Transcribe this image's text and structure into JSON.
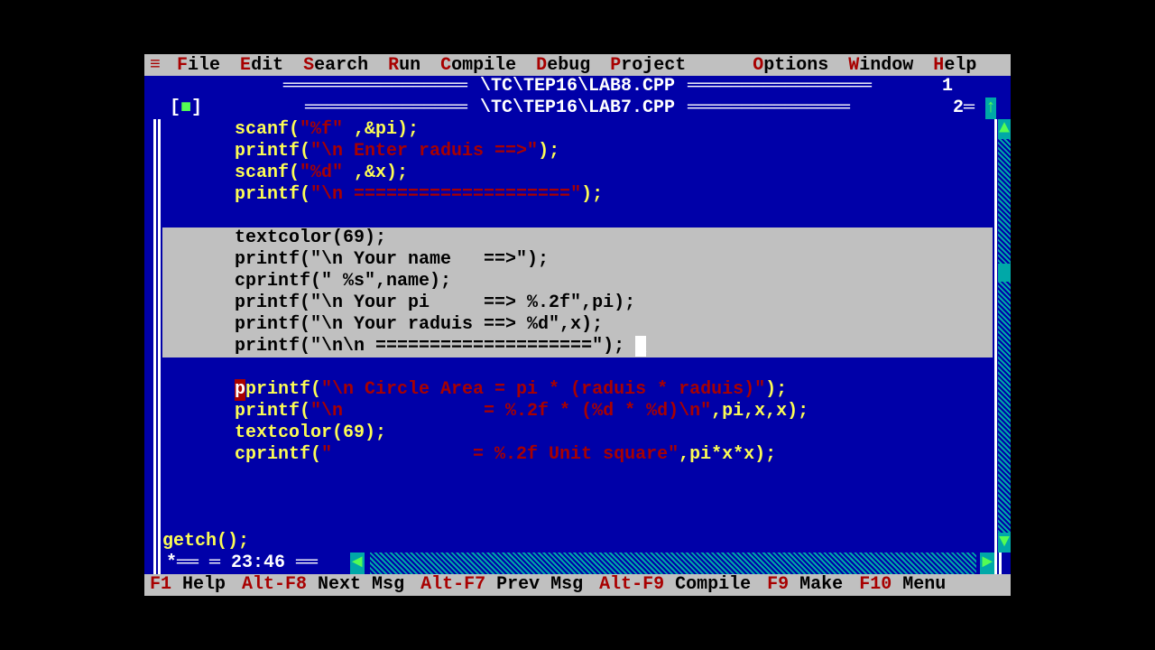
{
  "menu": {
    "items": [
      {
        "hot": "F",
        "rest": "ile"
      },
      {
        "hot": "E",
        "rest": "dit"
      },
      {
        "hot": "S",
        "rest": "earch"
      },
      {
        "hot": "R",
        "rest": "un"
      },
      {
        "hot": "C",
        "rest": "ompile"
      },
      {
        "hot": "D",
        "rest": "ebug"
      },
      {
        "hot": "P",
        "rest": "roject"
      },
      {
        "hot": "O",
        "rest": "ptions"
      },
      {
        "hot": "W",
        "rest": "indow"
      },
      {
        "hot": "H",
        "rest": "elp"
      }
    ]
  },
  "windows": {
    "back": {
      "title": "\\TC\\TEP16\\LAB8.CPP",
      "num": "1"
    },
    "front": {
      "title": "\\TC\\TEP16\\LAB7.CPP",
      "num": "2",
      "close": "[■]",
      "arrow": "[↑]"
    }
  },
  "editor": {
    "cursor_pos": "23:46",
    "lines": [
      {
        "sel": false,
        "indent": true,
        "pre": "scanf(",
        "str": "\"%f\"",
        "mid": " ,&pi);"
      },
      {
        "sel": false,
        "indent": true,
        "pre": "printf(",
        "str": "\"\\n Enter raduis ==>\"",
        "mid": ");"
      },
      {
        "sel": false,
        "indent": true,
        "pre": "scanf(",
        "str": "\"%d\"",
        "mid": " ,&x);"
      },
      {
        "sel": false,
        "indent": true,
        "pre": "printf(",
        "str": "\"\\n ====================\"",
        "mid": ");"
      },
      {
        "sel": false,
        "indent": true,
        "pre": "",
        "str": "",
        "mid": ""
      },
      {
        "sel": true,
        "indent": true,
        "pre": "textcolor(69);",
        "str": "",
        "mid": ""
      },
      {
        "sel": true,
        "indent": true,
        "pre": "printf(\"\\n Your name   ==>\");",
        "str": "",
        "mid": ""
      },
      {
        "sel": true,
        "indent": true,
        "pre": "cprintf(\" %s\",name);",
        "str": "",
        "mid": ""
      },
      {
        "sel": true,
        "indent": true,
        "pre": "printf(\"\\n Your pi     ==> %.2f\",pi);",
        "str": "",
        "mid": ""
      },
      {
        "sel": true,
        "indent": true,
        "pre": "printf(\"\\n Your raduis ==> %d\",x);",
        "str": "",
        "mid": ""
      },
      {
        "sel": true,
        "indent": true,
        "pre": "printf(\"\\n\\n ====================\");",
        "str": "",
        "mid": "",
        "cursor_after": true
      },
      {
        "sel": false,
        "indent": true,
        "pre": "",
        "str": "",
        "mid": ""
      },
      {
        "sel": false,
        "indent": true,
        "break": true,
        "pre": "printf(",
        "str": "\"\\n Circle Area = pi * (raduis * raduis)\"",
        "mid": ");"
      },
      {
        "sel": false,
        "indent": true,
        "pre": "printf(",
        "str": "\"\\n             = %.2f * (%d * %d)\\n\"",
        "mid": ",pi,x,x);"
      },
      {
        "sel": false,
        "indent": true,
        "pre": "textcolor(69);",
        "str": "",
        "mid": ""
      },
      {
        "sel": false,
        "indent": true,
        "pre": "cprintf(",
        "str": "\"             = %.2f Unit square\"",
        "mid": ",pi*x*x);"
      },
      {
        "sel": false,
        "indent": true,
        "pre": "",
        "str": "",
        "mid": ""
      },
      {
        "sel": false,
        "indent": true,
        "pre": "",
        "str": "",
        "mid": ""
      },
      {
        "sel": false,
        "indent": true,
        "pre": "",
        "str": "",
        "mid": ""
      },
      {
        "sel": false,
        "indent": false,
        "pre": "getch();",
        "str": "",
        "mid": ""
      }
    ]
  },
  "status": {
    "items": [
      {
        "key": "F1",
        "label": " Help"
      },
      {
        "key": "Alt-F8",
        "label": " Next Msg"
      },
      {
        "key": "Alt-F7",
        "label": " Prev Msg"
      },
      {
        "key": "Alt-F9",
        "label": " Compile"
      },
      {
        "key": "F9",
        "label": " Make"
      },
      {
        "key": "F10",
        "label": " Menu"
      }
    ]
  }
}
